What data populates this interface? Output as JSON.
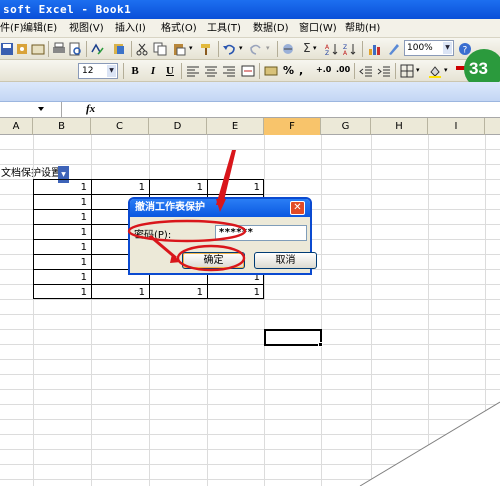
{
  "window": {
    "title": "soft Excel - Book1"
  },
  "menu": [
    {
      "label": "件(F)"
    },
    {
      "label": "编辑(E)"
    },
    {
      "label": "视图(V)"
    },
    {
      "label": "插入(I)"
    },
    {
      "label": "格式(O)"
    },
    {
      "label": "工具(T)"
    },
    {
      "label": "数据(D)"
    },
    {
      "label": "窗口(W)"
    },
    {
      "label": "帮助(H)"
    }
  ],
  "toolbar": {
    "zoom": "100%",
    "font_size": "12"
  },
  "protection_toolbar": {
    "label": "文档保护设置"
  },
  "formula_bar": {
    "fx": "fx"
  },
  "badge": {
    "text": "33"
  },
  "columns": [
    "A",
    "B",
    "C",
    "D",
    "E",
    "F",
    "G",
    "H",
    "I"
  ],
  "selected_column": "F",
  "cells": {
    "row1": [
      "1",
      "1",
      "1",
      "1"
    ],
    "col_b": [
      "1",
      "1",
      "1",
      "1",
      "1",
      "1",
      "1",
      "1"
    ],
    "row8": [
      "1",
      "1",
      "1",
      "1"
    ],
    "col_e_bottom": [
      "1",
      "1"
    ]
  },
  "dialog": {
    "title": "撤消工作表保护",
    "password_label": "密码(P):",
    "password_value": "******",
    "ok_label": "确定",
    "cancel_label": "取消",
    "close_label": "✕"
  },
  "colors": {
    "accent": "#0a57e0",
    "annotation": "#d9161b",
    "selected_header": "#f8c46b"
  }
}
